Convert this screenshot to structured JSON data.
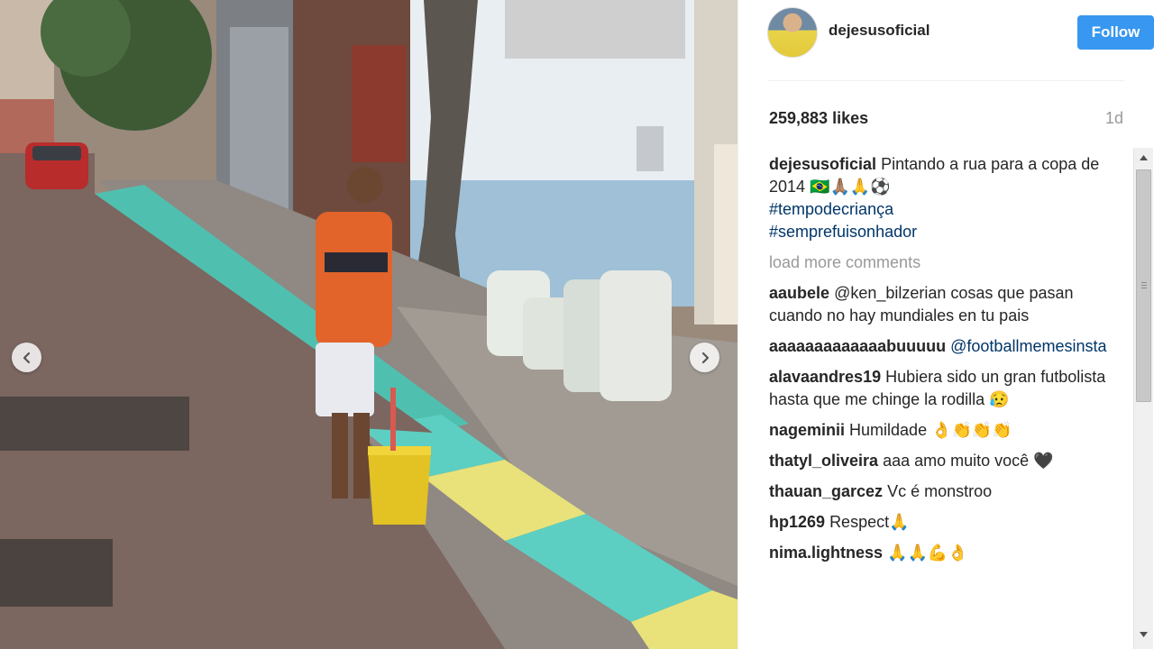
{
  "post": {
    "username": "dejesusoficial",
    "follow_label": "Follow",
    "likes": "259,883 likes",
    "timestamp": "1d",
    "caption": {
      "username": "dejesusoficial",
      "text": "Pintando a rua para a copa de 2014 🇧🇷🙏🏽🙏⚽",
      "hashtags": [
        "#tempodecriança",
        "#semprefuisonhador"
      ]
    },
    "load_more": "load more comments"
  },
  "comments": [
    {
      "user": "aaubele",
      "text": "@ken_bilzerian cosas que pasan cuando no hay mundiales en tu pais"
    },
    {
      "user": "aaaaaaaaaaaaabuuuuu",
      "text": "@footballmemesinsta"
    },
    {
      "user": "alavaandres19",
      "text": "Hubiera sido un gran futbolista hasta que me chinge la rodilla 😥"
    },
    {
      "user": "nageminii",
      "text": "Humildade 👌👏👏👏"
    },
    {
      "user": "thatyl_oliveira",
      "text": "aaa amo muito você 🖤"
    },
    {
      "user": "thauan_garcez",
      "text": "Vc é monstroo"
    },
    {
      "user": "hp1269",
      "text": "Respect🙏"
    },
    {
      "user": "nima.lightness",
      "text": "🙏🙏💪👌"
    }
  ],
  "icons": {
    "prev": "chevron-left-icon",
    "next": "chevron-right-icon",
    "scroll_up": "arrow-up-icon",
    "scroll_down": "arrow-down-icon"
  },
  "colors": {
    "follow_button": "#3897f0",
    "hashtag": "#003569",
    "muted": "#999999"
  }
}
